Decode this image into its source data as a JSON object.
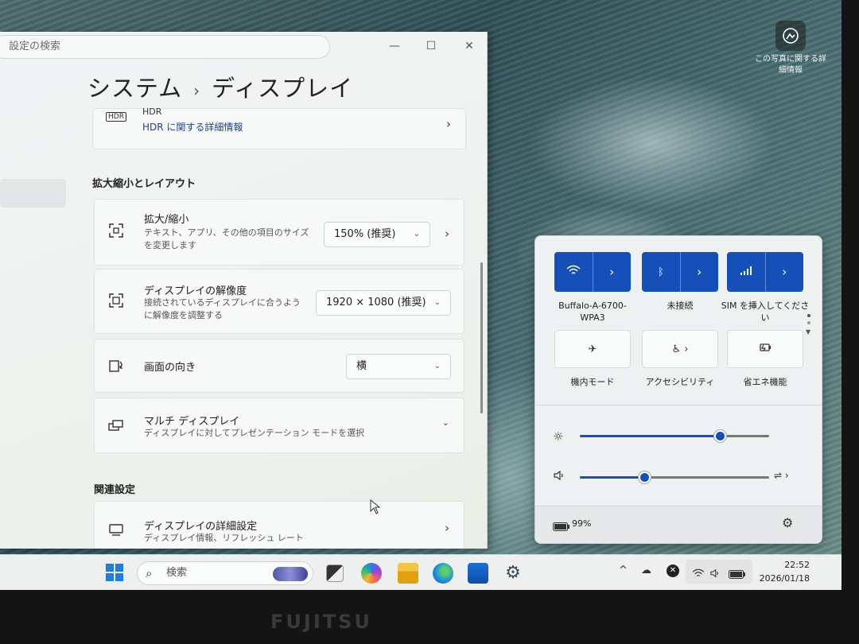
{
  "desktop": {
    "info_label": "この写真に関する詳細情報",
    "bezel_brand": "FUJITSU"
  },
  "settings": {
    "search_placeholder": "設定の検索",
    "breadcrumb_parent": "システム",
    "breadcrumb_separator": "›",
    "breadcrumb_current": "ディスプレイ",
    "hdr_card": {
      "title": "HDR",
      "link": "HDR に関する詳細情報"
    },
    "section_scale_layout": "拡大縮小とレイアウト",
    "scale": {
      "title": "拡大/縮小",
      "description": "テキスト、アプリ、その他の項目のサイズを変更します",
      "value": "150% (推奨)"
    },
    "resolution": {
      "title": "ディスプレイの解像度",
      "description": "接続されているディスプレイに合うように解像度を調整する",
      "value": "1920 × 1080 (推奨)"
    },
    "orientation": {
      "title": "画面の向き",
      "value": "横"
    },
    "multi_display": {
      "title": "マルチ ディスプレイ",
      "description": "ディスプレイに対してプレゼンテーション モードを選択"
    },
    "section_related": "関連設定",
    "advanced_display": {
      "title": "ディスプレイの詳細設定",
      "description": "ディスプレイ情報、リフレッシュ レート"
    }
  },
  "quick_settings": {
    "tiles": [
      {
        "label": "Buffalo-A-6700-WPA3",
        "icon": "wifi-icon",
        "state": "on"
      },
      {
        "label": "未接続",
        "icon": "bluetooth-icon",
        "state": "on"
      },
      {
        "label": "SIM を挿入してください",
        "icon": "cellular-icon",
        "state": "on"
      },
      {
        "label": "機内モード",
        "icon": "airplane-icon",
        "state": "off"
      },
      {
        "label": "アクセシビリティ",
        "icon": "accessibility-icon",
        "state": "off"
      },
      {
        "label": "省エネ機能",
        "icon": "energy-saver-icon",
        "state": "off"
      }
    ],
    "brightness_level": 0.74,
    "volume_level": 0.34,
    "battery": "99%",
    "accent_color": "#1550b8"
  },
  "taskbar": {
    "search_label": "検索",
    "time": "22:52",
    "date": "2026/01/18"
  }
}
